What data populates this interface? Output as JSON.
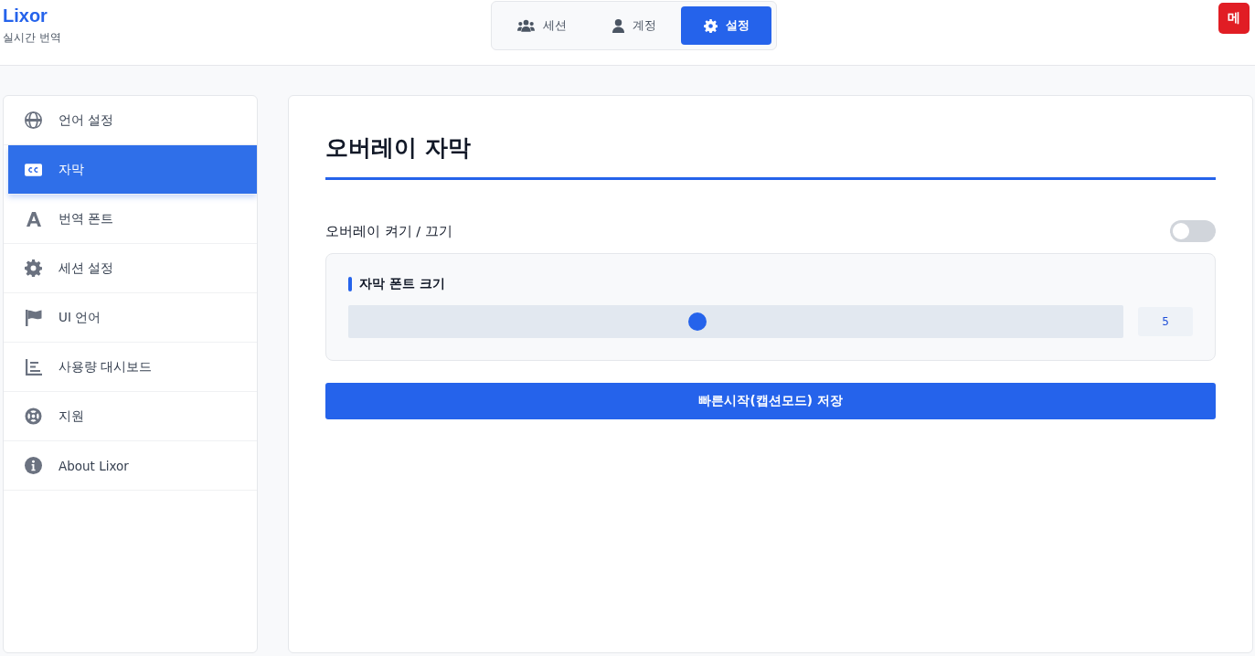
{
  "app": {
    "title": "Lixor",
    "subtitle": "실시간 번역"
  },
  "tabs": [
    {
      "label": "세션",
      "selected": false
    },
    {
      "label": "계정",
      "selected": false
    },
    {
      "label": "설정",
      "selected": true
    }
  ],
  "menu_button": "메",
  "sidebar": {
    "items": [
      {
        "label": "언어 설정",
        "selected": false
      },
      {
        "label": "자막",
        "selected": true
      },
      {
        "label": "번역 폰트",
        "selected": false
      },
      {
        "label": "세션 설정",
        "selected": false
      },
      {
        "label": "UI 언어",
        "selected": false
      },
      {
        "label": "사용량 대시보드",
        "selected": false
      },
      {
        "label": "지원",
        "selected": false
      },
      {
        "label": "About Lixor",
        "selected": false
      }
    ]
  },
  "content": {
    "title": "오버레이 자막",
    "overlay_toggle": {
      "label": "오버레이 켜기 / 끄기",
      "on": false
    },
    "font_size": {
      "label": "자막 폰트 크기",
      "level": 0.45,
      "value": "5"
    },
    "save_button": "빠른시작(캡션모드) 저장"
  }
}
